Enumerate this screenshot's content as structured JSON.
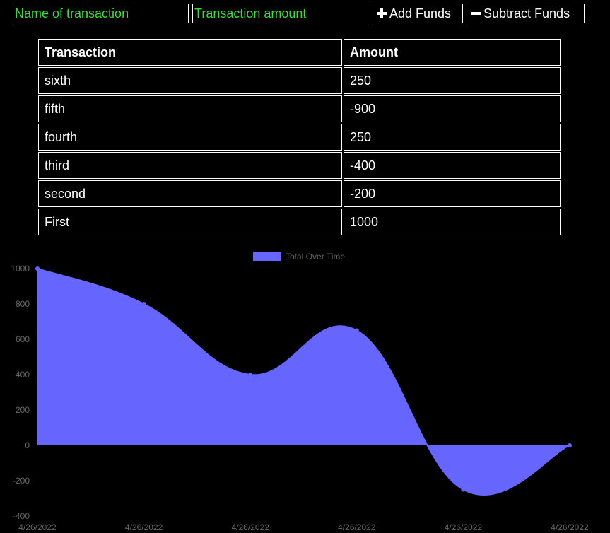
{
  "form": {
    "name_placeholder": "Name of transaction",
    "amount_placeholder": "Transaction amount",
    "add_label": "Add Funds",
    "subtract_label": "Subtract Funds"
  },
  "table": {
    "headers": [
      "Transaction",
      "Amount"
    ],
    "rows": [
      {
        "name": "sixth",
        "amount": "250"
      },
      {
        "name": "fifth",
        "amount": "-900"
      },
      {
        "name": "fourth",
        "amount": "250"
      },
      {
        "name": "third",
        "amount": "-400"
      },
      {
        "name": "second",
        "amount": "-200"
      },
      {
        "name": "First",
        "amount": "1000"
      }
    ]
  },
  "colors": {
    "background": "#000000",
    "input_text": "#3ddc3d",
    "border": "#ffffff",
    "series_fill": "#6666ff",
    "axis_text": "#666666"
  },
  "chart_data": {
    "type": "area",
    "legend": "Total Over Time",
    "legend_position": "top-center",
    "x": [
      "4/26/2022",
      "4/26/2022",
      "4/26/2022",
      "4/26/2022",
      "4/26/2022",
      "4/26/2022"
    ],
    "series": [
      {
        "name": "Total Over Time",
        "values": [
          1000,
          800,
          400,
          650,
          -250,
          0
        ]
      }
    ],
    "yticks": [
      "1000",
      "800",
      "600",
      "400",
      "200",
      "0",
      "-200",
      "-400"
    ],
    "ylim": [
      -400,
      1000
    ],
    "grid": false
  }
}
